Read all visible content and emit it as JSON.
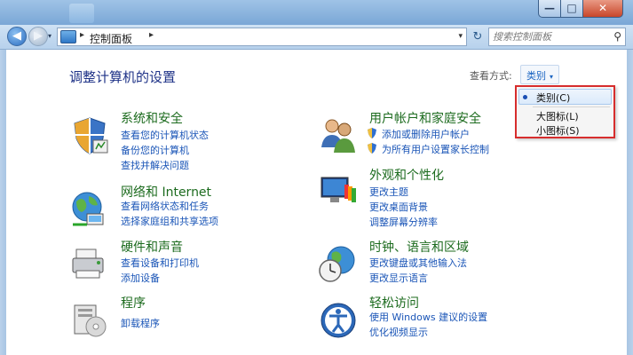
{
  "address": {
    "crumb": "控制面板",
    "separator": "▸",
    "dropdown_glyph": "▾"
  },
  "search": {
    "placeholder": "搜索控制面板"
  },
  "header": {
    "title": "调整计算机的设置",
    "view_by_label": "查看方式:",
    "view_by_value": "类别"
  },
  "view_menu": {
    "options": [
      "类别(C)",
      "大图标(L)",
      "小图标(S)"
    ],
    "selected": "类别(C)"
  },
  "categories": [
    {
      "name": "系统和安全",
      "icon": "system-security-icon",
      "links": [
        "查看您的计算机状态",
        "备份您的计算机",
        "查找并解决问题"
      ]
    },
    {
      "name": "网络和 Internet",
      "icon": "network-internet-icon",
      "links": [
        "查看网络状态和任务",
        "选择家庭组和共享选项"
      ]
    },
    {
      "name": "硬件和声音",
      "icon": "hardware-sound-icon",
      "links": [
        "查看设备和打印机",
        "添加设备"
      ]
    },
    {
      "name": "程序",
      "icon": "programs-icon",
      "links": [
        "卸载程序"
      ]
    },
    {
      "name": "用户帐户和家庭安全",
      "icon": "user-accounts-icon",
      "links": [
        "添加或删除用户帐户",
        "为所有用户设置家长控制"
      ]
    },
    {
      "name": "外观和个性化",
      "icon": "appearance-icon",
      "links": [
        "更改主题",
        "更改桌面背景",
        "调整屏幕分辨率"
      ]
    },
    {
      "name": "时钟、语言和区域",
      "icon": "clock-language-icon",
      "links": [
        "更改键盘或其他输入法",
        "更改显示语言"
      ]
    },
    {
      "name": "轻松访问",
      "icon": "ease-of-access-icon",
      "links": [
        "使用 Windows 建议的设置",
        "优化视频显示"
      ]
    }
  ],
  "window_controls": {
    "minimize": "—",
    "maximize": "□",
    "close": "✕"
  },
  "nav": {
    "back": "◀",
    "forward": "▶",
    "refresh": "↻",
    "search_glyph": "⚲"
  },
  "colors": {
    "link": "#1a55b7",
    "category_title": "#1c6b1e",
    "page_title": "#1e3287",
    "highlight_border": "#d72d2d"
  }
}
